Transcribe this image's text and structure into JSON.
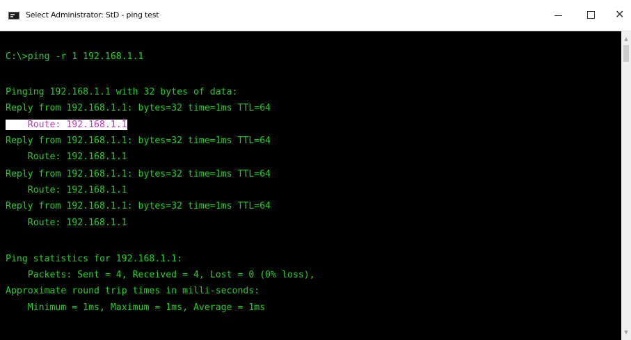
{
  "window": {
    "title": "Select Administrator: StD - ping test",
    "controls": {
      "minimize": "–",
      "maximize": "☐",
      "close": "✕"
    }
  },
  "console": {
    "lines": [
      "C:\\>ping -r 1 192.168.1.1",
      "",
      "Pinging 192.168.1.1 with 32 bytes of data:",
      "Reply from 192.168.1.1: bytes=32 time=1ms TTL=64",
      "    Route: 192.168.1.1",
      "Reply from 192.168.1.1: bytes=32 time=1ms TTL=64",
      "    Route: 192.168.1.1",
      "Reply from 192.168.1.1: bytes=32 time=1ms TTL=64",
      "    Route: 192.168.1.1",
      "Reply from 192.168.1.1: bytes=32 time=1ms TTL=64",
      "    Route: 192.168.1.1",
      "",
      "Ping statistics for 192.168.1.1:",
      "    Packets: Sent = 4, Received = 4, Lost = 0 (0% loss),",
      "Approximate round trip times in milli-seconds:",
      "    Minimum = 1ms, Maximum = 1ms, Average = 1ms"
    ],
    "highlighted_line_index": 4,
    "colors": {
      "text": "#1ed61e",
      "background": "#000000",
      "highlight_bg": "#ffffff",
      "highlight_text": "#d22cd2"
    }
  },
  "icons": {
    "app": "cmd-console-icon",
    "scroll_up": "chevron-up-icon",
    "scroll_down": "chevron-down-icon"
  }
}
